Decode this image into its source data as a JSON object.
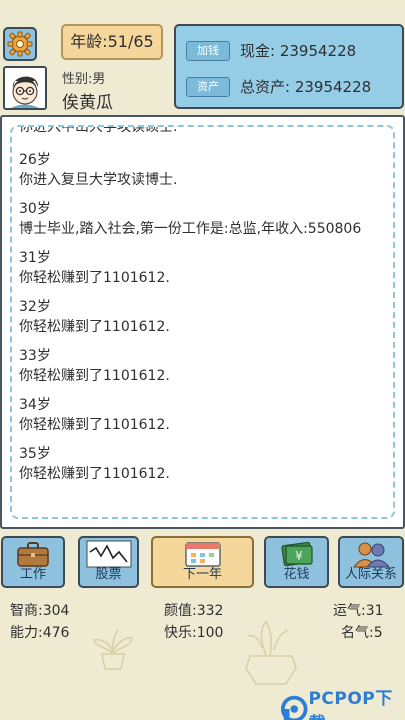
{
  "header": {
    "age": "年龄:51/65",
    "gender": "性别:男",
    "name": "俟黄瓜"
  },
  "money": {
    "cash_tag": "加钱",
    "cash": "现金: 23954228",
    "assets_tag": "资产",
    "assets": "总资产: 23954228"
  },
  "log": {
    "partial_line": "你进入中山大学攻读硕士.",
    "entries": [
      {
        "age": "26岁",
        "text": "你进入复旦大学攻读博士."
      },
      {
        "age": "30岁",
        "text": "博士毕业,踏入社会,第一份工作是:总监,年收入:550806"
      },
      {
        "age": "31岁",
        "text": "你轻松赚到了1101612."
      },
      {
        "age": "32岁",
        "text": "你轻松赚到了1101612."
      },
      {
        "age": "33岁",
        "text": "你轻松赚到了1101612."
      },
      {
        "age": "34岁",
        "text": "你轻松赚到了1101612."
      },
      {
        "age": "35岁",
        "text": "你轻松赚到了1101612."
      }
    ]
  },
  "buttons": {
    "work": "工作",
    "stock": "股票",
    "next_year": "下一年",
    "spend": "花钱",
    "relations": "人际关系"
  },
  "stats": {
    "iq": "智商:304",
    "looks": "颜值:332",
    "luck": "运气:31",
    "ability": "能力:476",
    "happiness": "快乐:100",
    "fame": "名气:5"
  },
  "watermark": {
    "brand": "PCPOP下载"
  },
  "icons": {
    "settings": "gear-icon",
    "avatar": "avatar-face-icon",
    "work": "briefcase-icon",
    "stock": "stock-chart-icon",
    "next_year": "calendar-icon",
    "spend": "money-icon",
    "relations": "people-icon"
  },
  "colors": {
    "background": "#efebd3",
    "panel_blue": "#95cde7",
    "button_blue": "#8ec1dd",
    "button_gold": "#f5d79c",
    "dashed_border": "#8ec4df",
    "watermark_blue": "#2c7dd6"
  }
}
